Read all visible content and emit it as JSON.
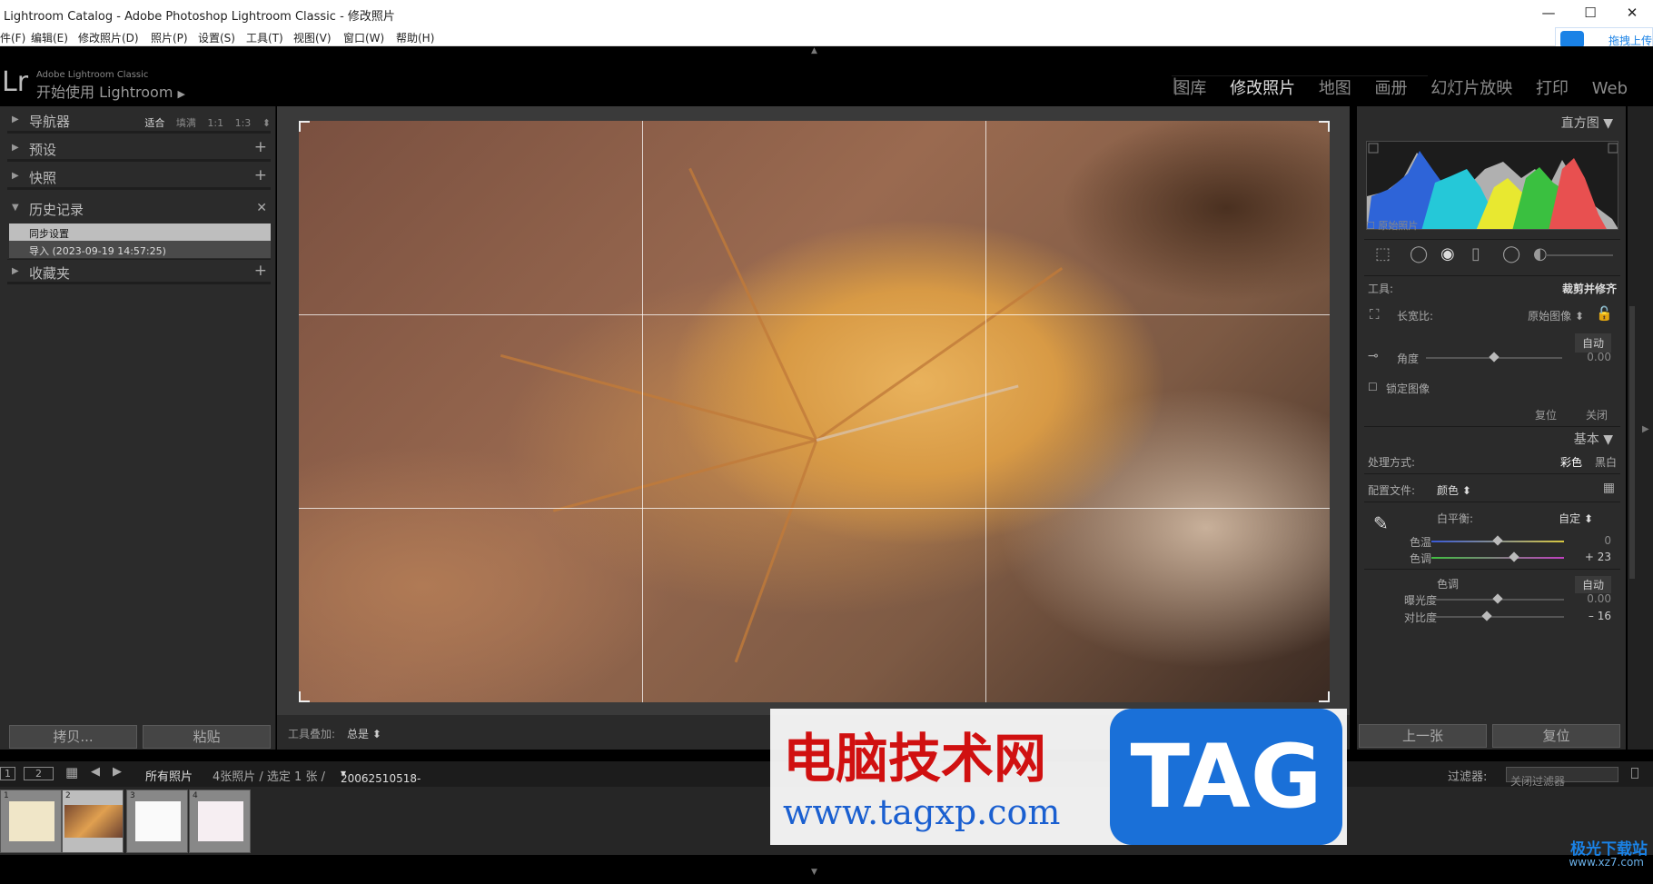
{
  "window": {
    "title": "Lightroom Catalog - Adobe Photoshop Lightroom Classic - 修改照片",
    "minimize": "—",
    "maximize": "☐",
    "close": "✕"
  },
  "menu": [
    "件(F)",
    "编辑(E)",
    "修改照片(D)",
    "照片(P)",
    "设置(S)",
    "工具(T)",
    "视图(V)",
    "窗口(W)",
    "帮助(H)"
  ],
  "upload": {
    "label": "拖拽上传",
    "icon": "cloud-icon"
  },
  "identity": {
    "logo": "Lr",
    "line1": "Adobe Lightroom Classic",
    "line2": "开始使用 Lightroom",
    "arrow": "▶"
  },
  "modules": [
    "图库",
    "修改照片",
    "地图",
    "画册",
    "幻灯片放映",
    "打印",
    "Web"
  ],
  "active_module": "修改照片",
  "left_panel": {
    "navigator": {
      "label": "导航器",
      "options": [
        "适合",
        "填满",
        "1:1",
        "1:3"
      ],
      "active": "适合"
    },
    "presets": {
      "label": "预设"
    },
    "snapshots": {
      "label": "快照"
    },
    "history": {
      "label": "历史记录",
      "items": [
        "同步设置",
        "导入 (2023-09-19 14:57:25)"
      ]
    },
    "collections": {
      "label": "收藏夹"
    },
    "copy_button": "拷贝...",
    "paste_button": "粘贴"
  },
  "center": {
    "toolbar_label": "工具叠加:",
    "toolbar_value": "总是"
  },
  "right_panel": {
    "histogram_label": "直方图",
    "original_photo": "原始照片",
    "tool_label": "工具:",
    "tool_value": "裁剪并修齐",
    "aspect_label": "长宽比:",
    "aspect_value": "原始图像",
    "auto_label": "自动",
    "angle_label": "角度",
    "angle_value": "0.00",
    "lock_image": "锁定图像",
    "reset": "复位",
    "close": "关闭",
    "basic_label": "基本",
    "treatment_label": "处理方式:",
    "treatment_color": "彩色",
    "treatment_bw": "黑白",
    "profile_label": "配置文件:",
    "profile_value": "颜色",
    "wb_label": "白平衡:",
    "wb_value": "自定",
    "temp_label": "色温",
    "temp_value": "0",
    "tint_label": "色调",
    "tint_value": "+ 23",
    "tone_label": "色调",
    "tone_auto": "自动",
    "exposure_label": "曝光度",
    "exposure_value": "0.00",
    "contrast_label": "对比度",
    "contrast_value": "– 16",
    "prev_button": "上一张",
    "reset_button": "复位",
    "slider_levels": {
      "angle": 0.5,
      "temp": 0.5,
      "tint": 0.62,
      "exposure": 0.5,
      "contrast": 0.42
    }
  },
  "filmstrip_bar": {
    "view1": "1",
    "view2": "2",
    "source": "所有照片",
    "count": "4张照片 / 选定 1 张 /",
    "filename": "20062510518-6-1200.raw",
    "filter_label": "过滤器:",
    "filter_value": "关闭过滤器"
  },
  "thumbnails": [
    {
      "num": "1"
    },
    {
      "num": "2"
    },
    {
      "num": "3"
    },
    {
      "num": "4"
    }
  ],
  "watermark": {
    "cn": "电脑技术网",
    "url": "www.tagxp.com",
    "tag": "TAG"
  },
  "corner_logo": {
    "text": "极光下载站",
    "url": "www.xz7.com"
  }
}
